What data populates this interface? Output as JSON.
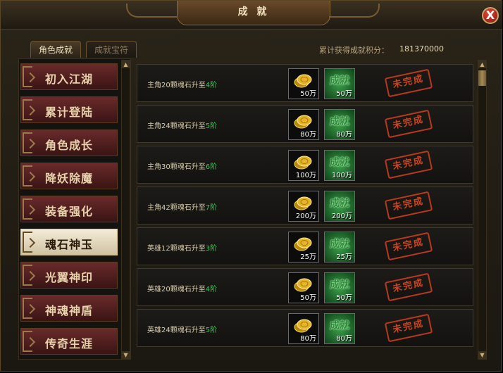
{
  "window": {
    "title": "成 就",
    "close_label": "X"
  },
  "tabs": [
    {
      "label": "角色成就",
      "active": true
    },
    {
      "label": "成就宝符",
      "active": false
    }
  ],
  "score": {
    "label": "累计获得成就积分：",
    "value": "181370000"
  },
  "categories": [
    {
      "label": "初入江湖",
      "active": false
    },
    {
      "label": "累计登陆",
      "active": false
    },
    {
      "label": "角色成长",
      "active": false
    },
    {
      "label": "降妖除魔",
      "active": false
    },
    {
      "label": "装备强化",
      "active": false
    },
    {
      "label": "魂石神玉",
      "active": true
    },
    {
      "label": "光翼神印",
      "active": false
    },
    {
      "label": "神魂神盾",
      "active": false
    },
    {
      "label": "传奇生涯",
      "active": false
    }
  ],
  "achievements": [
    {
      "text": "主角20颗魂石升至",
      "level": "4阶",
      "gold": "50万",
      "ach_label": "成就",
      "points": "50万",
      "status": "未完成"
    },
    {
      "text": "主角24颗魂石升至",
      "level": "5阶",
      "gold": "80万",
      "ach_label": "成就",
      "points": "80万",
      "status": "未完成"
    },
    {
      "text": "主角30颗魂石升至",
      "level": "6阶",
      "gold": "100万",
      "ach_label": "成就",
      "points": "100万",
      "status": "未完成"
    },
    {
      "text": "主角42颗魂石升至",
      "level": "7阶",
      "gold": "200万",
      "ach_label": "成就",
      "points": "200万",
      "status": "未完成"
    },
    {
      "text": "英雄12颗魂石升至",
      "level": "3阶",
      "gold": "25万",
      "ach_label": "成就",
      "points": "25万",
      "status": "未完成"
    },
    {
      "text": "英雄20颗魂石升至",
      "level": "4阶",
      "gold": "50万",
      "ach_label": "成就",
      "points": "50万",
      "status": "未完成"
    },
    {
      "text": "英雄24颗魂石升至",
      "level": "5阶",
      "gold": "80万",
      "ach_label": "成就",
      "points": "80万",
      "status": "未完成"
    }
  ],
  "scroll_arrows": {
    "up": "▲",
    "down": "▼"
  },
  "colors": {
    "level_text": "#2ad24a",
    "stamp": "#c84624",
    "active_category": "#f4ecd8"
  }
}
